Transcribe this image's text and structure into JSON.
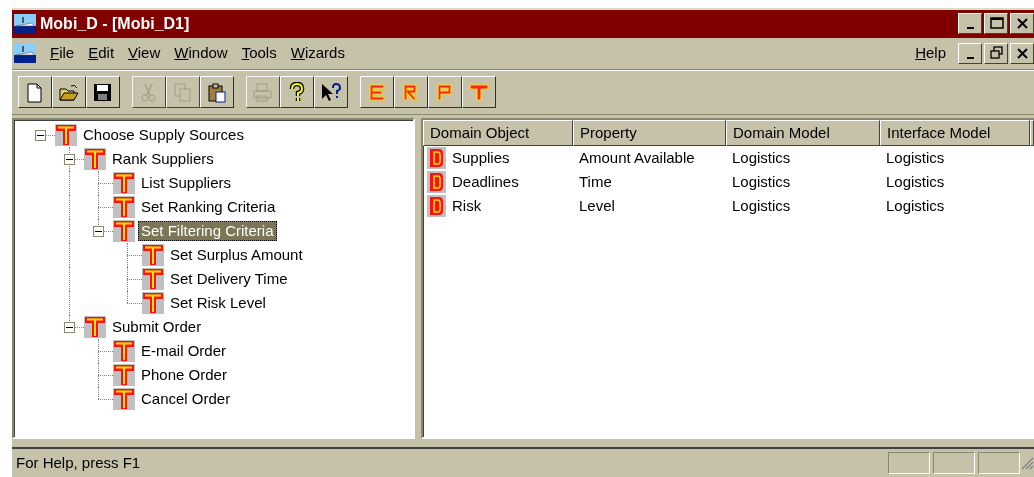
{
  "window": {
    "title": "Mobi_D - [Mobi_D1]"
  },
  "menu_bar": {
    "items": [
      {
        "label_parts": [
          "F",
          "ile"
        ]
      },
      {
        "label_parts": [
          "E",
          "dit"
        ]
      },
      {
        "label_parts": [
          "V",
          "iew"
        ]
      },
      {
        "label_parts": [
          "W",
          "indow"
        ]
      },
      {
        "label_parts": [
          "T",
          "ools"
        ]
      },
      {
        "label_parts": [
          "W",
          "izards"
        ]
      }
    ],
    "help": {
      "label_parts": [
        "H",
        "elp"
      ]
    }
  },
  "toolbar": {
    "groups": [
      [
        {
          "kind": "new",
          "disabled": false
        },
        {
          "kind": "open",
          "disabled": false
        },
        {
          "kind": "save",
          "disabled": false
        }
      ],
      [
        {
          "kind": "cut",
          "disabled": true
        },
        {
          "kind": "copy",
          "disabled": true
        },
        {
          "kind": "paste",
          "disabled": false
        }
      ],
      [
        {
          "kind": "print",
          "disabled": true
        },
        {
          "kind": "help",
          "disabled": false
        },
        {
          "kind": "context-help",
          "disabled": false
        }
      ],
      [
        {
          "kind": "letter-e",
          "disabled": false
        },
        {
          "kind": "letter-r",
          "disabled": false
        },
        {
          "kind": "letter-p",
          "disabled": false
        },
        {
          "kind": "letter-t",
          "disabled": false
        }
      ]
    ]
  },
  "tree": [
    {
      "label": "Choose Supply Sources",
      "selected": false,
      "expanded": true,
      "children": [
        {
          "label": "Rank Suppliers",
          "selected": false,
          "expanded": true,
          "children": [
            {
              "label": "List Suppliers",
              "selected": false
            },
            {
              "label": "Set Ranking Criteria",
              "selected": false
            },
            {
              "label": "Set Filtering Criteria",
              "selected": true,
              "expanded": true,
              "children": [
                {
                  "label": "Set Surplus Amount",
                  "selected": false
                },
                {
                  "label": "Set Delivery Time",
                  "selected": false
                },
                {
                  "label": "Set Risk Level",
                  "selected": false
                }
              ]
            }
          ]
        },
        {
          "label": "Submit Order",
          "selected": false,
          "expanded": true,
          "children": [
            {
              "label": "E-mail Order",
              "selected": false
            },
            {
              "label": "Phone Order",
              "selected": false
            },
            {
              "label": "Cancel Order",
              "selected": false
            }
          ]
        }
      ]
    }
  ],
  "table": {
    "columns": [
      "Domain Object",
      "Property",
      "Domain Model",
      "Interface Model"
    ],
    "rows": [
      [
        "Supplies",
        "Amount Available",
        "Logistics",
        "Logistics"
      ],
      [
        "Deadlines",
        "Time",
        "Logistics",
        "Logistics"
      ],
      [
        "Risk",
        "Level",
        "Logistics",
        "Logistics"
      ]
    ]
  },
  "status_bar": {
    "text": "For Help, press F1"
  }
}
